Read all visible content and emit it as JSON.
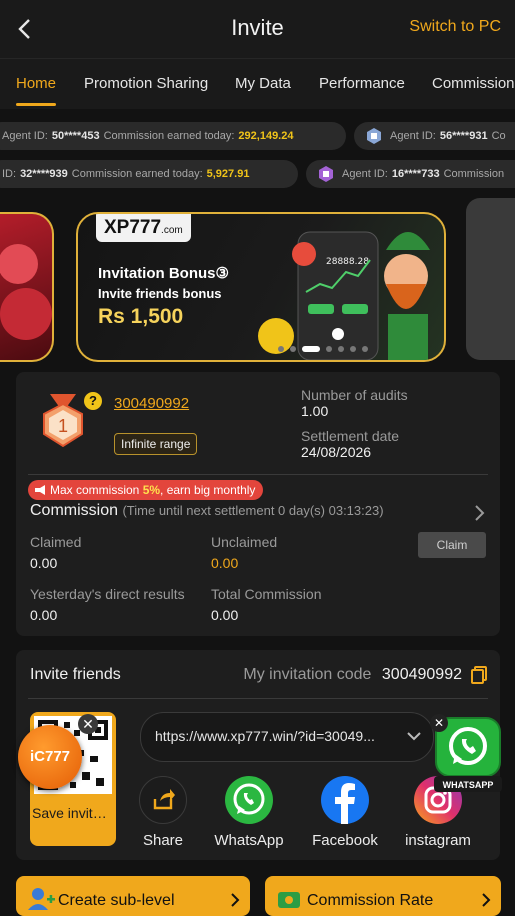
{
  "header": {
    "title": "Invite",
    "switch_label": "Switch to PC"
  },
  "tabs": [
    {
      "label": "Home",
      "active": true
    },
    {
      "label": "Promotion Sharing"
    },
    {
      "label": "My Data"
    },
    {
      "label": "Performance"
    },
    {
      "label": "Commission"
    }
  ],
  "ticker_row1": [
    {
      "agent_label": "Agent ID:",
      "agent": "50****453",
      "comm_label": "Commission earned today:",
      "amount": "292,149.24"
    },
    {
      "agent_label": "Agent ID:",
      "agent": "56****931",
      "comm_label": "Co"
    }
  ],
  "ticker_row2": [
    {
      "agent_label": "ID:",
      "agent": "32****939",
      "comm_label": "Commission earned today:",
      "amount": "5,927.91"
    },
    {
      "agent_label": "Agent ID:",
      "agent": "16****733",
      "comm_label": "Commission"
    }
  ],
  "banner": {
    "logo": "XP777",
    "logo_suffix": ".com",
    "title": "Invitation Bonus③",
    "subtitle": "Invite friends bonus",
    "amount": "Rs 1,500",
    "chart_value": "28888.28",
    "active_slide_fraction": 0.43
  },
  "overview": {
    "agent_id": "300490992",
    "level": "1",
    "range_label": "Infinite range",
    "audits_label": "Number of audits",
    "audits_value": "1.00",
    "settlement_label": "Settlement date",
    "settlement_value": "24/08/2026",
    "promo_prefix": "Max commission ",
    "promo_pct": "5%",
    "promo_suffix": ", earn big monthly",
    "commission_title": "Commission",
    "commission_hint": "(Time until next settlement  0 day(s) 03:13:23)",
    "claimed_label": "Claimed",
    "claimed_value": "0.00",
    "unclaimed_label": "Unclaimed",
    "unclaimed_value": "0.00",
    "claim_button": "Claim",
    "yesterday_label": "Yesterday's direct results",
    "yesterday_value": "0.00",
    "total_label": "Total Commission",
    "total_value": "0.00"
  },
  "invite": {
    "title": "Invite friends",
    "code_label": "My invitation code",
    "code": "300490992",
    "link": "https://www.xp777.win/?id=30049...",
    "save_label": "Save invitation...",
    "float_logo": "iC777",
    "share_items": [
      {
        "label": "Share",
        "icon": "share-icon",
        "color": "#1c1c1c"
      },
      {
        "label": "WhatsApp",
        "icon": "whatsapp-icon",
        "color": "#2bb741"
      },
      {
        "label": "Facebook",
        "icon": "facebook-icon",
        "color": "#1877f2"
      },
      {
        "label": "instagram",
        "icon": "instagram-icon",
        "color": "#d62976"
      }
    ],
    "whatsapp_float_label": "WHATSAPP"
  },
  "bottom": {
    "create_label": "Create sub-level",
    "rate_label": "Commission Rate"
  },
  "colors": {
    "accent": "#f0a81c",
    "background": "#121212",
    "card": "#1e1e1e"
  }
}
